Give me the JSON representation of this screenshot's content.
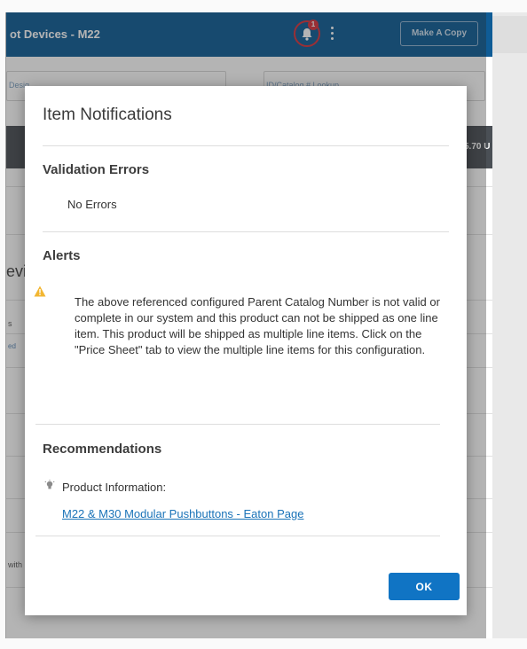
{
  "app": {
    "title": "ot Devices - M22",
    "notification_count": "1",
    "make_copy_label": "Make A Copy",
    "left_field_fragment": "Desig",
    "lookup_label": "ID/Catalog # Lookup",
    "total_fragment": "5.70 U",
    "bg_heading_fragment": "evic",
    "bg_text_s": "s",
    "bg_text_ed": "ed",
    "bg_text_with": "with"
  },
  "modal": {
    "title": "Item Notifications",
    "validation": {
      "heading": "Validation Errors",
      "message": "No Errors"
    },
    "alerts": {
      "heading": "Alerts",
      "message": "The above referenced configured Parent Catalog Number is not valid or complete in our system and this product can not be shipped as one line item. This product will be shipped as multiple line items. Click on the \"Price Sheet\" tab to view the multiple line items for this configuration."
    },
    "recommendations": {
      "heading": "Recommendations",
      "label": "Product Information:",
      "link_text": "M22 & M30 Modular Pushbuttons - Eaton Page"
    },
    "ok_label": "OK"
  },
  "colors": {
    "header_blue": "#0f5c96",
    "badge_red": "#d8343c",
    "ok_blue": "#1074c4",
    "link_blue": "#1a73b8",
    "warning_amber": "#f2b632"
  },
  "icons": {
    "notification": "bell-icon",
    "menu": "kebab-menu-icon",
    "alert": "warning-triangle-icon",
    "recommendation": "lightbulb-icon"
  }
}
